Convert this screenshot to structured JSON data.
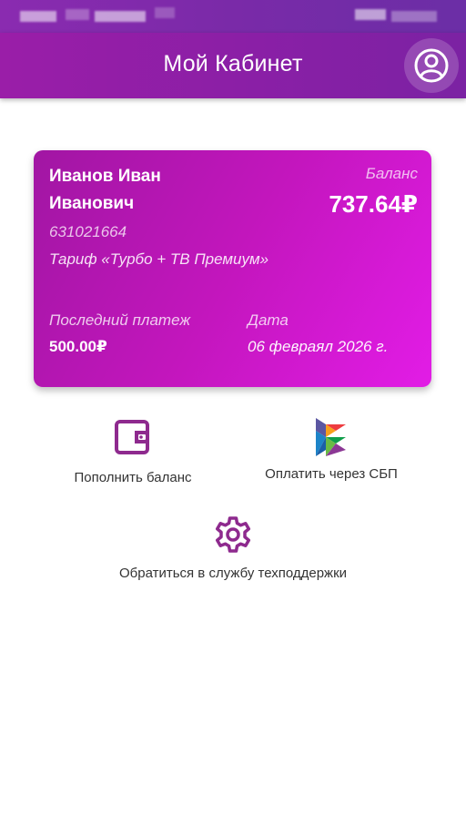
{
  "header": {
    "title": "Мой Кабинет",
    "profile_icon": "account-circle-icon"
  },
  "card": {
    "name_line1": "Иванов Иван",
    "name_line2": "Иванович",
    "balance_label": "Баланс",
    "balance_value": "737.64₽",
    "account_number": "631021664",
    "tariff": "Тариф «Турбо + ТВ Премиум»",
    "last_payment_label": "Последний платеж",
    "last_payment_value": "500.00₽",
    "date_label": "Дата",
    "date_value": "06 февраял 2026 г."
  },
  "actions": {
    "top_up": {
      "label": "Пополнить баланс",
      "icon": "wallet-icon"
    },
    "sbp": {
      "label": "Оплатить через СБП",
      "icon": "sbp-logo-icon"
    },
    "support": {
      "label": "Обратиться в службу техподдержки",
      "icon": "gear-icon"
    }
  },
  "colors": {
    "brand_purple": "#8a1fa6",
    "card_start": "#a116a3",
    "card_end": "#e21ce6",
    "icon_purple": "#8e2a8e"
  }
}
